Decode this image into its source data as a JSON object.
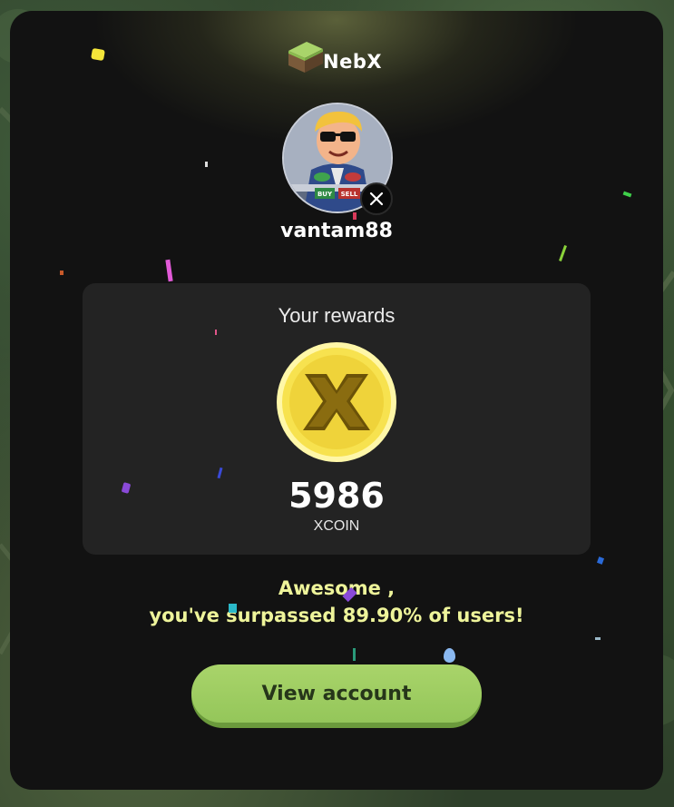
{
  "brand": {
    "name": "NebX"
  },
  "profile": {
    "username": "vantam88",
    "avatar_badges": [
      "BUY",
      "SELL"
    ],
    "social_icon": "x-logo-icon"
  },
  "rewards": {
    "title": "Your rewards",
    "amount": "5986",
    "unit": "XCOIN",
    "coin_icon": "xcoin-icon"
  },
  "message": {
    "line1": "Awesome ,",
    "line2": "you've surpassed 89.90% of users!"
  },
  "actions": {
    "view_account_label": "View account"
  },
  "colors": {
    "card_bg": "#121212",
    "panel_bg": "#232323",
    "accent_green": "#a2cd63",
    "message_yellow": "#eef49a",
    "coin_yellow": "#f7e24f"
  }
}
